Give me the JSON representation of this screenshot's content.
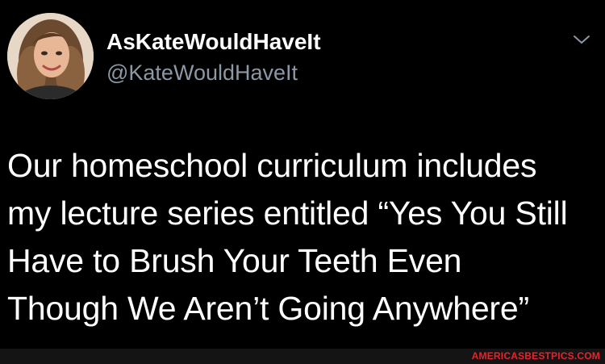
{
  "account": {
    "display_name": "AsKateWouldHaveIt",
    "handle": "@KateWouldHaveIt",
    "avatar_icon": "profile-photo"
  },
  "tweet": {
    "lines": [
      "Our homeschool curriculum includes",
      "my lecture series entitled “Yes You Still",
      "Have to Brush Your Teeth Even",
      "Though We Aren’t Going Anywhere”"
    ]
  },
  "menu": {
    "icon": "chevron-down-icon"
  },
  "watermark": {
    "text": "AMERICASBESTPICS.COM",
    "color": "#e8232a"
  },
  "theme": {
    "background": "#000000",
    "text": "#ffffff",
    "secondary_text": "#8b98a5"
  }
}
